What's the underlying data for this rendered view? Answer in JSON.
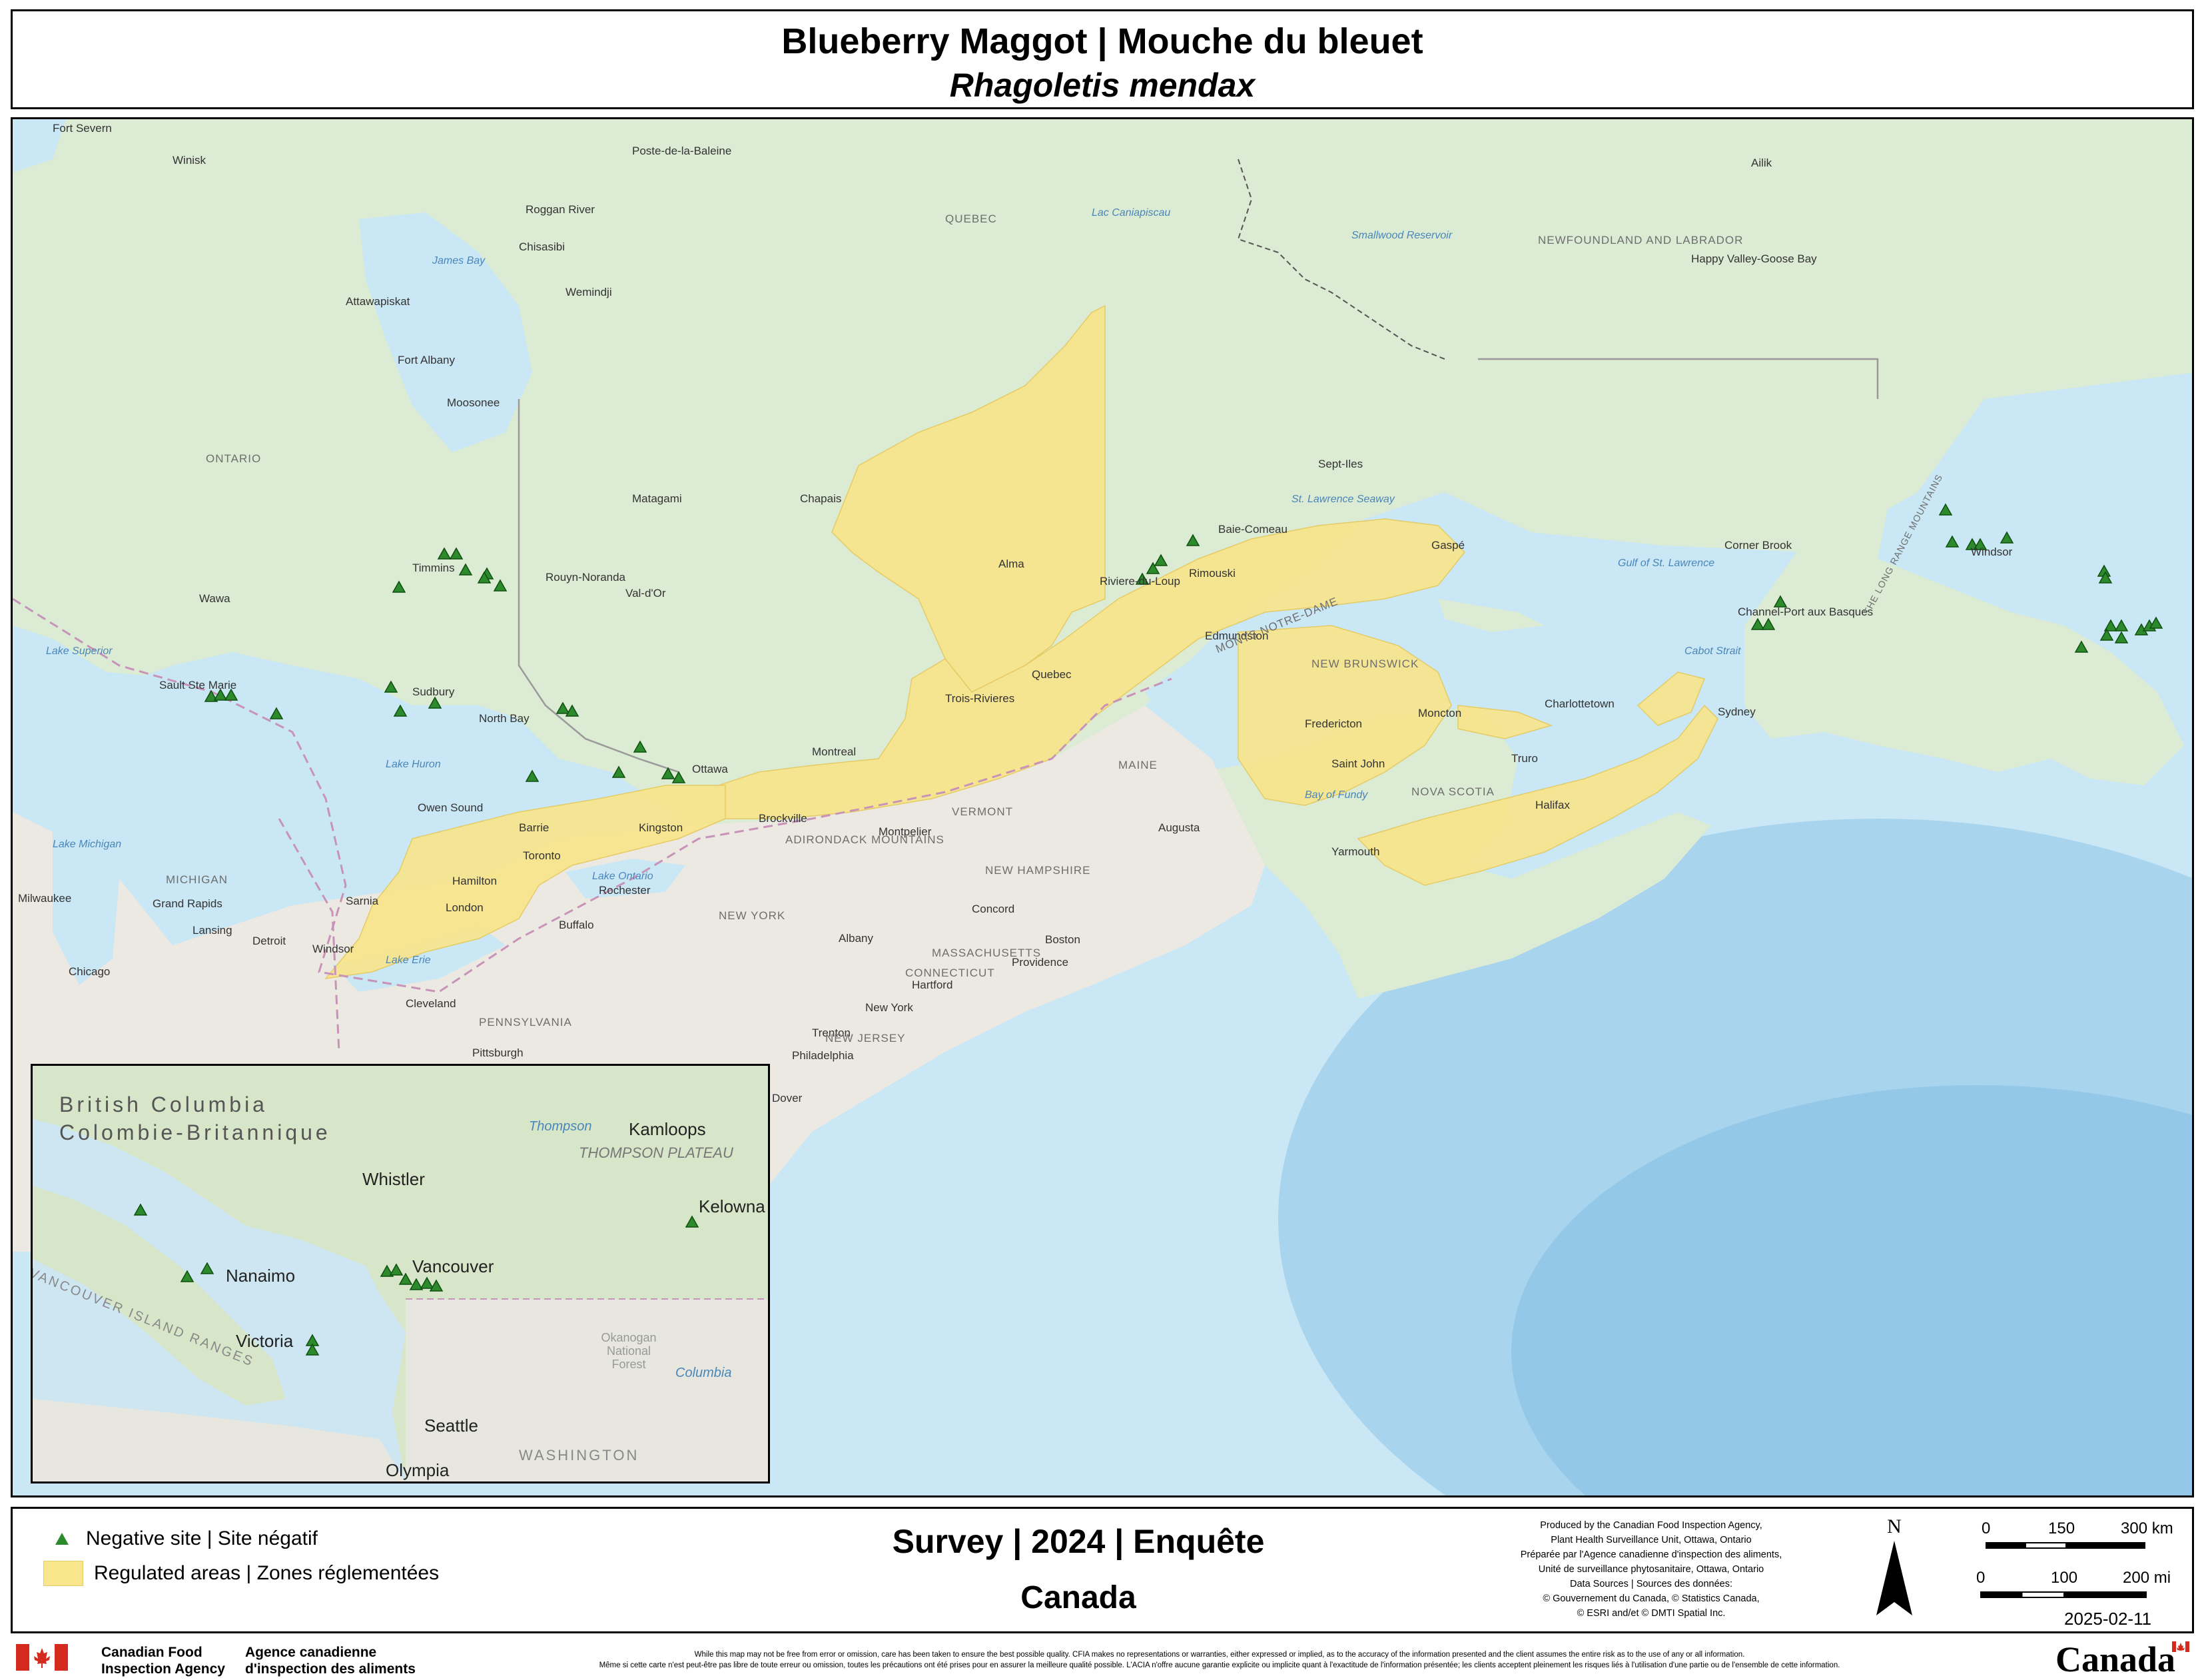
{
  "title": {
    "line1": "Blueberry Maggot | Mouche du bleuet",
    "line2": "Rhagoletis mendax"
  },
  "legend": {
    "negative_site": "Negative site | Site négatif",
    "regulated_areas": "Regulated areas | Zones réglementées",
    "survey": "Survey | 2024 | Enquête",
    "country": "Canada"
  },
  "colors": {
    "regulated": "#f8e58c",
    "site_marker": "#2c8a2c",
    "water": "#bfe0f0",
    "land": "#dde9d2"
  },
  "credits": [
    "Produced by the Canadian Food Inspection Agency,",
    "Plant Health Surveillance Unit, Ottawa, Ontario",
    "Préparée par l'Agence canadienne d'inspection des aliments,",
    "Unité de surveillance phytosanitaire, Ottawa, Ontario",
    "Data Sources | Sources des données:",
    "© Gouvernement du Canada, © Statistics Canada,",
    "© ESRI and/et © DMTI Spatial Inc."
  ],
  "north_label": "N",
  "scale": {
    "km_labels": [
      "0",
      "150",
      "300 km"
    ],
    "mi_labels": [
      "0",
      "100",
      "200 mi"
    ]
  },
  "date": "2025-02-11",
  "footer": {
    "agency_en": [
      "Canadian Food",
      "Inspection Agency"
    ],
    "agency_fr": [
      "Agence canadienne",
      "d'inspection des aliments"
    ],
    "disclaimer_en": "While this map may not be free from error or omission, care has been taken to ensure the best possible quality. CFIA makes no representations or warranties, either expressed or implied, as to the accuracy of the information presented and the client assumes the entire risk as to the use of any or all information.",
    "disclaimer_fr": "Même si cette carte n'est peut-être pas libre de toute erreur ou omission, toutes les précautions ont été prises pour en assurer la meilleure qualité possible. L'ACIA n'offre aucune garantie explicite ou implicite quant à l'exactitude de l'information présentée; les clients acceptent pleinement les risques liés à l'utilisation d'une partie ou de l'ensemble de cette information.",
    "wordmark": "Canada"
  },
  "map_labels": {
    "places": [
      "Fort Severn",
      "Winisk",
      "Poste-de-la-Baleine",
      "Roggan River",
      "Chisasibi",
      "Wemindji",
      "Attawapiskat",
      "Fort Albany",
      "Moosonee",
      "Timmins",
      "Rouyn-Noranda",
      "Val-d'Or",
      "Matagami",
      "Chapais",
      "Wawa",
      "Sault Ste Marie",
      "Sudbury",
      "North Bay",
      "Ottawa",
      "Montreal",
      "Quebec",
      "Trois-Rivieres",
      "Alma",
      "Sept-Iles",
      "Baie-Comeau",
      "Rimouski",
      "Riviere-du-Loup",
      "Edmundston",
      "Fredericton",
      "Saint John",
      "Moncton",
      "Charlottetown",
      "Truro",
      "Halifax",
      "Yarmouth",
      "Sydney",
      "Gaspé",
      "Corner Brook",
      "Channel-Port aux Basques",
      "Windsor",
      "Happy Valley-Goose Bay",
      "Ailik",
      "Owen Sound",
      "Barrie",
      "Kingston",
      "Toronto",
      "Hamilton",
      "London",
      "Sarnia",
      "Windsor",
      "Brockville",
      "Montpelier",
      "Augusta",
      "Concord",
      "Boston",
      "Providence",
      "Hartford",
      "Rochester",
      "Buffalo",
      "Albany",
      "New York",
      "Trenton",
      "Philadelphia",
      "Dover",
      "Pittsburgh",
      "Cleveland",
      "Detroit",
      "Lansing",
      "Grand Rapids",
      "Milwaukee",
      "Chicago"
    ],
    "regions": [
      "ONTARIO",
      "QUEBEC",
      "NEWFOUNDLAND AND LABRADOR",
      "NEW BRUNSWICK",
      "NOVA SCOTIA",
      "MAINE",
      "VERMONT",
      "NEW HAMPSHIRE",
      "MASSACHUSETTS",
      "CONNECTICUT",
      "NEW YORK",
      "PENNSYLVANIA",
      "NEW JERSEY",
      "MICHIGAN",
      "ADIRONDACK MOUNTAINS",
      "MONTS NOTRE-DAME",
      "THE LONG RANGE MOUNTAINS"
    ],
    "water": [
      "James Bay",
      "Lake Superior",
      "Lake Huron",
      "Lake Michigan",
      "Lake Erie",
      "Lake Ontario",
      "Gulf of St. Lawrence",
      "Cabot Strait",
      "Bay of Fundy",
      "St. Lawrence Seaway",
      "Smallwood Reservoir",
      "Lac Caniapiscau"
    ]
  },
  "inset": {
    "title_en": "British Columbia",
    "title_fr": "Colombie-Britannique",
    "labels": [
      "Kamloops",
      "THOMPSON PLATEAU",
      "Whistler",
      "Vancouver",
      "Nanaimo",
      "Victoria",
      "Seattle",
      "Olympia",
      "Kelowna",
      "WASHINGTON",
      "VANCOUVER ISLAND RANGES",
      "Okanogan National Forest",
      "Thompson",
      "Columbia"
    ]
  }
}
